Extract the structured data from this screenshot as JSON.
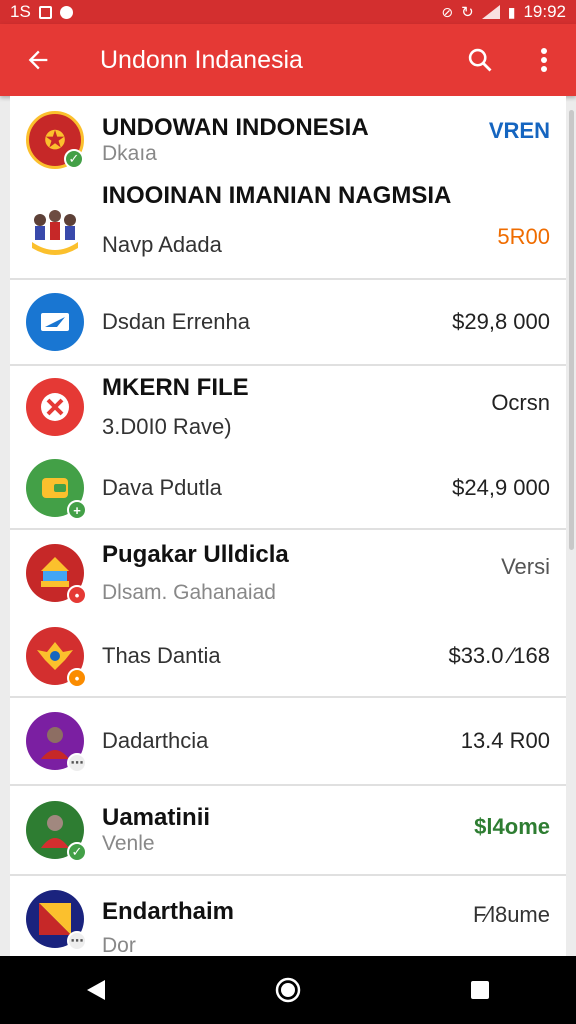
{
  "status_bar": {
    "left": "1S",
    "time": "19:92"
  },
  "app_bar": {
    "title": "Undonn Indanesia"
  },
  "items": [
    {
      "title": "UNDOWAN INDONESIA",
      "subtitle": "Dkaıa",
      "right": "VREN",
      "right_color": "#1565c0"
    },
    {
      "title": "INOOINAN IMANIAN NAGMSIA",
      "subtitle": "Navp Adada",
      "right": "5R00",
      "right_color": "#ef6c00"
    },
    {
      "title": "Dsdan Errenha",
      "right": "$29,8 000",
      "right_color": "#222222"
    },
    {
      "title": "MKERN FILE",
      "subtitle": "3.D0I0 Rave)",
      "right": "Ocrsn",
      "right_color": "#222222"
    },
    {
      "title": "Dava Pdutla",
      "right": "$24,9 000",
      "right_color": "#222222"
    },
    {
      "title": "Pugakar Ulldicla",
      "subtitle": "Dlsam. Gahanaiad",
      "right": "Versi",
      "right_color": "#555555"
    },
    {
      "title": "Thas Dantia",
      "right": "$33.0 ⁄168",
      "right_color": "#222222"
    },
    {
      "title": "Dadarthcia",
      "right": "13.4 R00",
      "right_color": "#222222"
    },
    {
      "title": "Uamatinii",
      "subtitle": "Venle",
      "right": "$l4ome",
      "right_color": "#2e7d32"
    },
    {
      "title": "Endarthaim",
      "subtitle": "Dor",
      "right": "F⁄l8ume",
      "right_color": "#333333"
    }
  ],
  "icons": {
    "back": "arrow-left-icon",
    "search": "search-icon",
    "more": "more-vert-icon",
    "nav_back": "triangle-back-icon",
    "nav_home": "circle-home-icon",
    "nav_recent": "square-recent-icon"
  },
  "colors": {
    "status_bar": "#d32f2f",
    "app_bar": "#e53935",
    "nav_bar": "#000000"
  }
}
